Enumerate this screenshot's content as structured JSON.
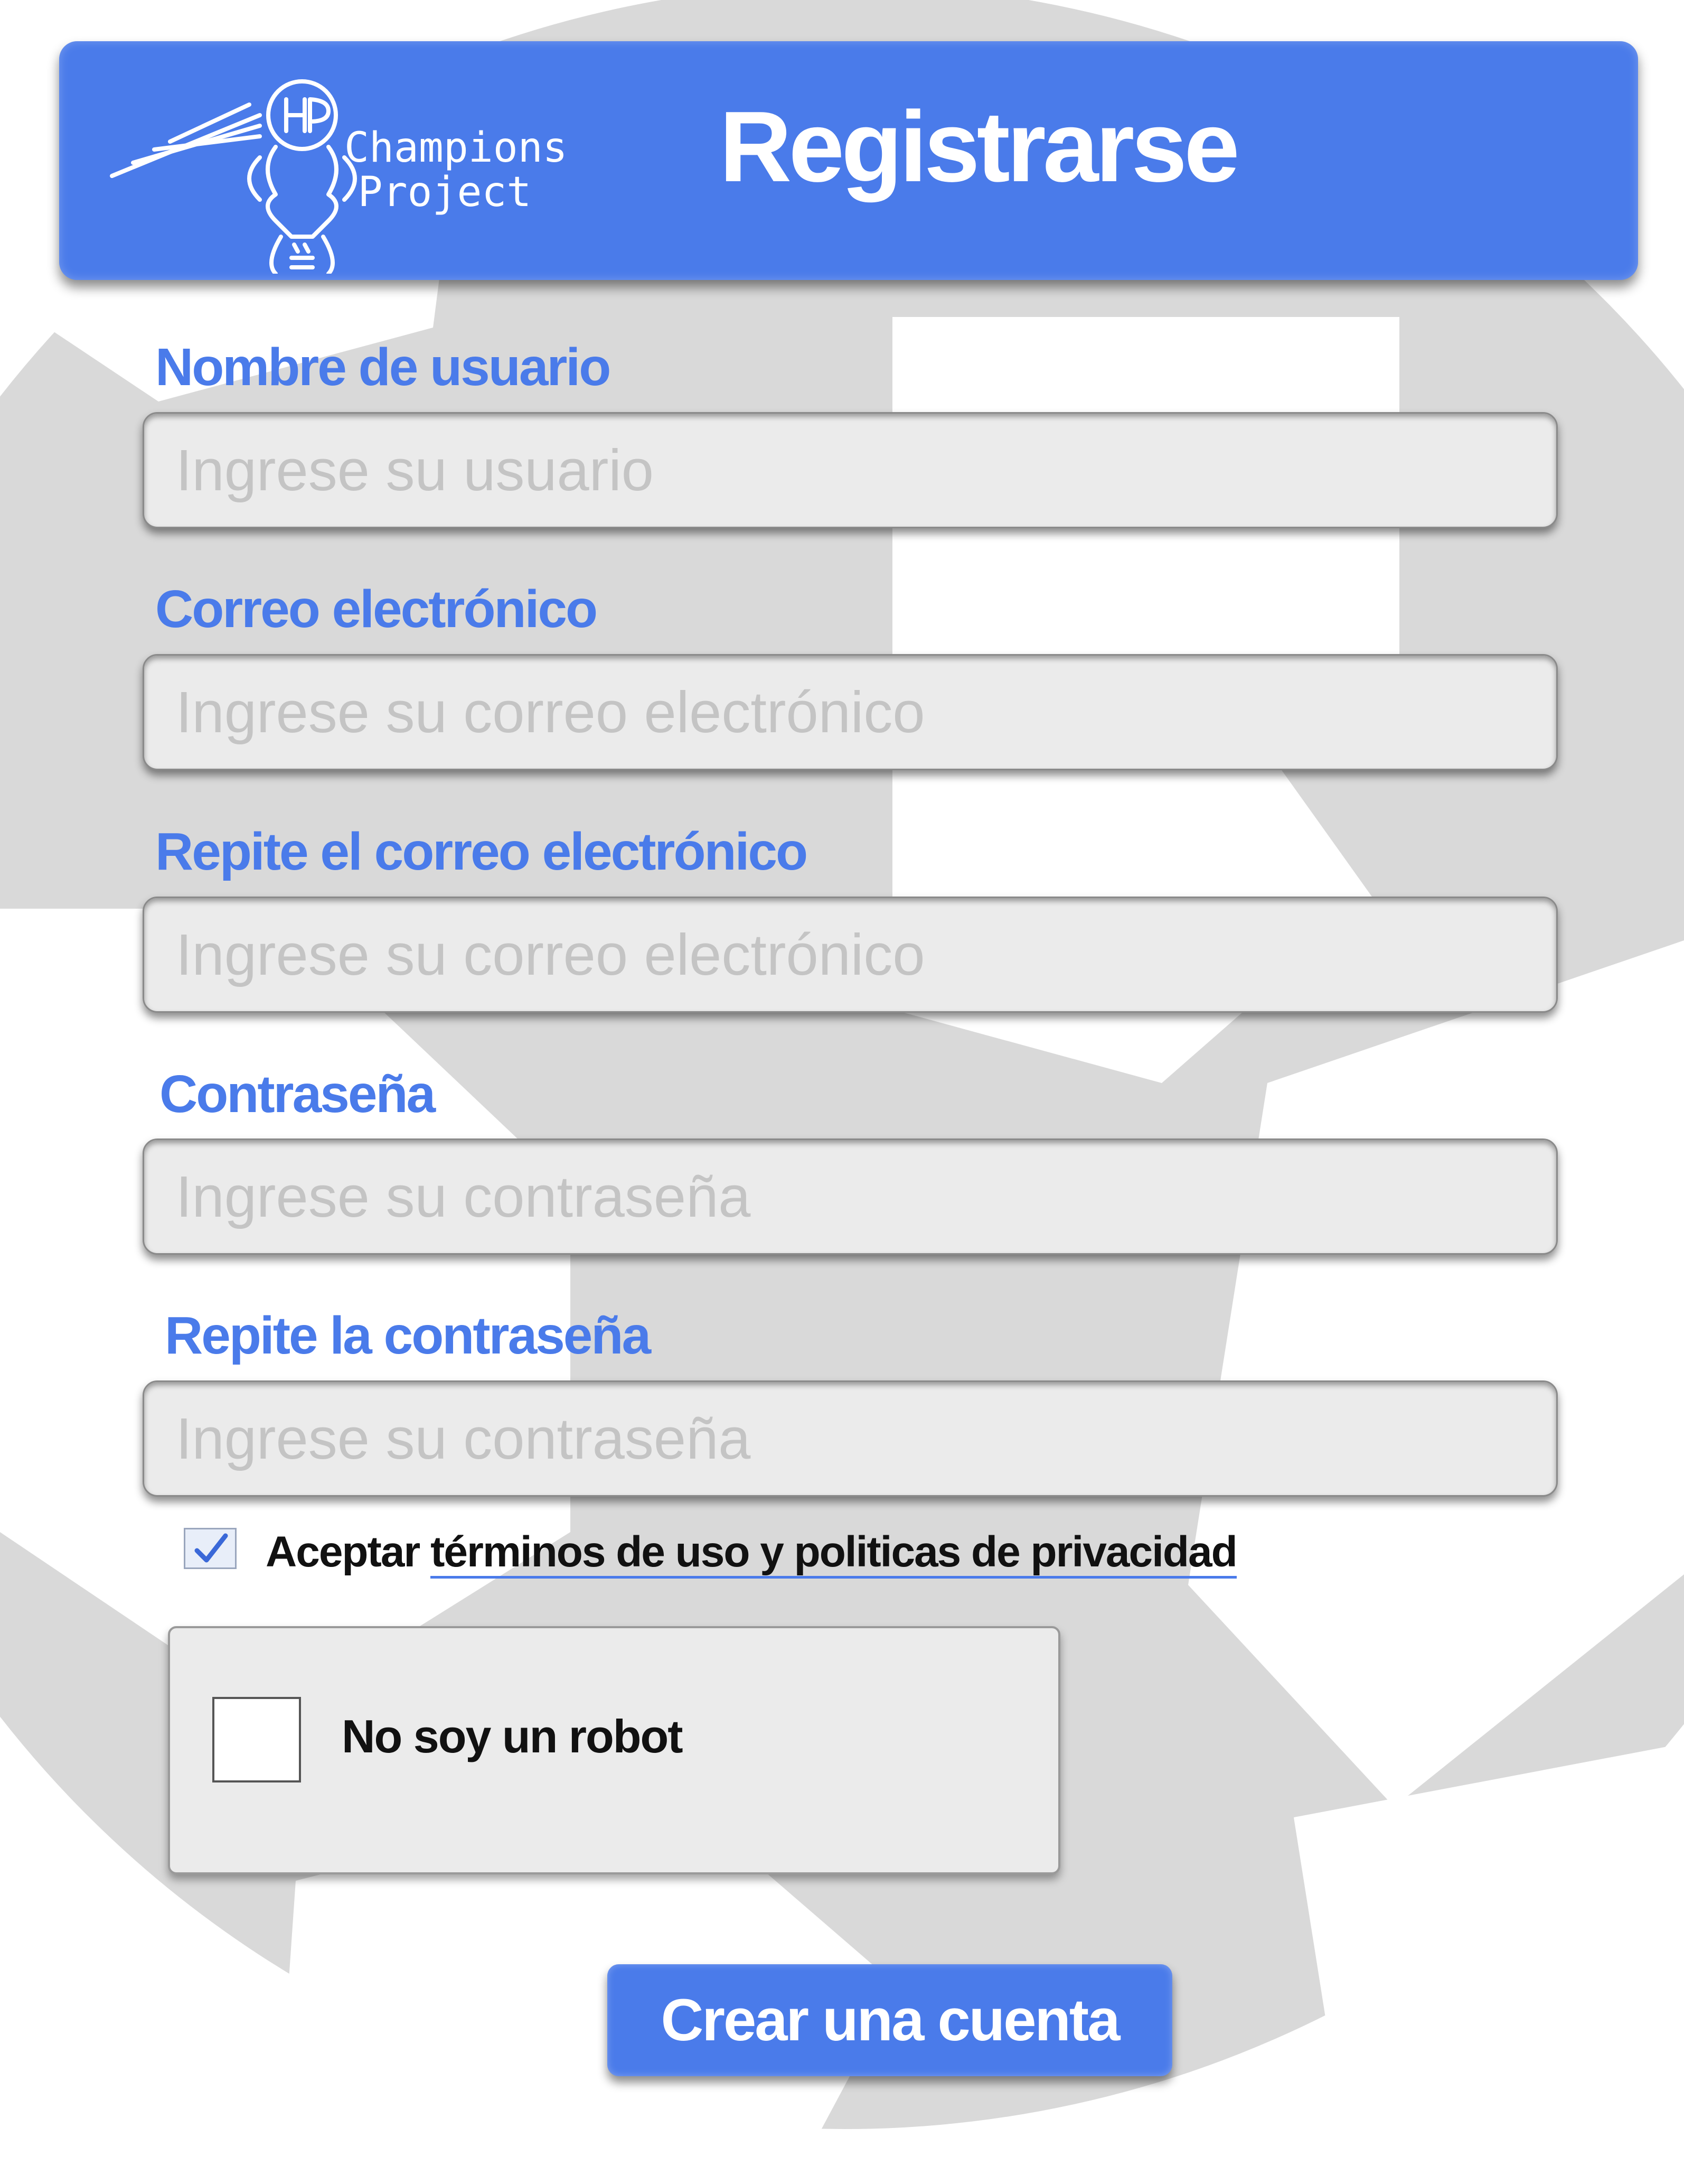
{
  "app": {
    "brand_line1": "Champions",
    "brand_line2": "Project",
    "logo_icon": "trophy-player-logo-icon",
    "title": "Registrarse"
  },
  "form": {
    "fields": [
      {
        "label": "Nombre de usuario",
        "placeholder": "Ingrese su usuario",
        "value": ""
      },
      {
        "label": "Correo electrónico",
        "placeholder": "Ingrese su correo electrónico",
        "value": ""
      },
      {
        "label": "Repite el correo electrónico",
        "placeholder": "Ingrese su correo electrónico",
        "value": ""
      },
      {
        "label": "Contraseña",
        "placeholder": "Ingrese su contraseña",
        "value": ""
      },
      {
        "label": "Repite la contraseña",
        "placeholder": "Ingrese su contraseña",
        "value": ""
      }
    ],
    "terms": {
      "checked": true,
      "prefix": "Aceptar ",
      "link_text": "términos de uso y politicas de privacidad"
    },
    "captcha": {
      "checked": false,
      "label": "No soy un robot"
    },
    "submit_label": "Crear una cuenta"
  },
  "colors": {
    "accent": "#4a7bea",
    "input_bg": "#ebebeb",
    "placeholder": "#c4c4c4",
    "background_pattern": "#d9d9d9"
  }
}
